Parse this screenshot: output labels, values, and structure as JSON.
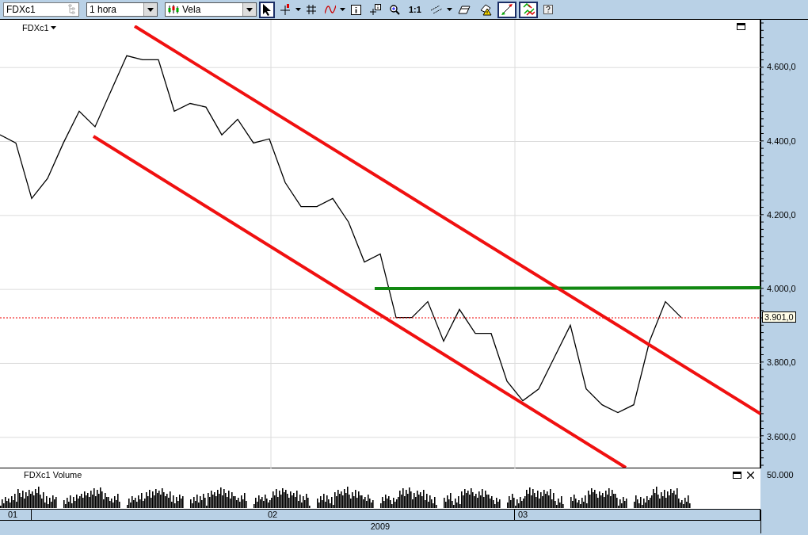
{
  "toolbar": {
    "symbol": "FDXc1",
    "interval": "1 hora",
    "chart_type": "Vela",
    "tools": [
      {
        "kind": "pointer",
        "selected": true,
        "menu": false
      },
      {
        "kind": "crosshair",
        "selected": false,
        "menu": true
      },
      {
        "kind": "grid",
        "selected": false,
        "menu": false
      },
      {
        "kind": "indicator",
        "selected": false,
        "menu": true
      },
      {
        "kind": "info",
        "selected": false,
        "menu": false
      },
      {
        "kind": "note",
        "selected": false,
        "menu": false
      },
      {
        "kind": "zoom",
        "selected": false,
        "menu": false
      },
      {
        "kind": "ratio",
        "label": "1:1",
        "selected": false,
        "menu": false
      },
      {
        "kind": "lines",
        "selected": false,
        "menu": true
      },
      {
        "kind": "eraser",
        "selected": false,
        "menu": false
      },
      {
        "kind": "alert",
        "selected": false,
        "menu": false
      },
      {
        "kind": "arrow",
        "selected": true,
        "menu": false
      },
      {
        "kind": "colors",
        "selected": true,
        "menu": false
      },
      {
        "kind": "help",
        "selected": false,
        "menu": false
      }
    ]
  },
  "price_chart": {
    "title": "FDXc1",
    "last_price": "3.901,0",
    "chart_data": {
      "type": "line",
      "values": [
        4418,
        4396,
        4246,
        4300,
        4396,
        4482,
        4440,
        4536,
        4632,
        4621,
        4621,
        4482,
        4503,
        4493,
        4418,
        4460,
        4396,
        4407,
        4289,
        4224,
        4224,
        4246,
        4182,
        4074,
        4096,
        3924,
        3924,
        3967,
        3860,
        3946,
        3881,
        3881,
        3752,
        3699,
        3731,
        3817,
        3903,
        3731,
        3688,
        3667,
        3688,
        3860,
        3967,
        3924
      ],
      "grid": true,
      "ylim": [
        3516,
        4729
      ],
      "yticks": [
        {
          "value": 3600,
          "label": "3.600,0"
        },
        {
          "value": 3800,
          "label": "3.800,0"
        },
        {
          "value": 4000,
          "label": "4.000,0"
        },
        {
          "value": 4200,
          "label": "4.200,0"
        },
        {
          "value": 4400,
          "label": "4.400,0"
        },
        {
          "value": 4600,
          "label": "4.600,0"
        }
      ]
    }
  },
  "volume_chart": {
    "title": "FDXc1 Volume",
    "axis_label": "50.000"
  },
  "date_axis": {
    "months": [
      "01",
      "02",
      "03"
    ],
    "year": "2009"
  }
}
